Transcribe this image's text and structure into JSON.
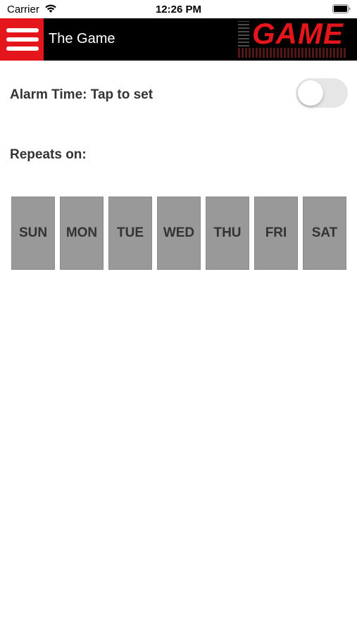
{
  "status_bar": {
    "carrier": "Carrier",
    "time": "12:26 PM"
  },
  "nav": {
    "title": "The Game",
    "logo_text": "GAME",
    "accent_color": "#e4161b"
  },
  "alarm": {
    "label": "Alarm Time: Tap to set",
    "enabled": false
  },
  "repeats": {
    "label": "Repeats on:",
    "days": [
      "SUN",
      "MON",
      "TUE",
      "WED",
      "THU",
      "FRI",
      "SAT"
    ]
  }
}
